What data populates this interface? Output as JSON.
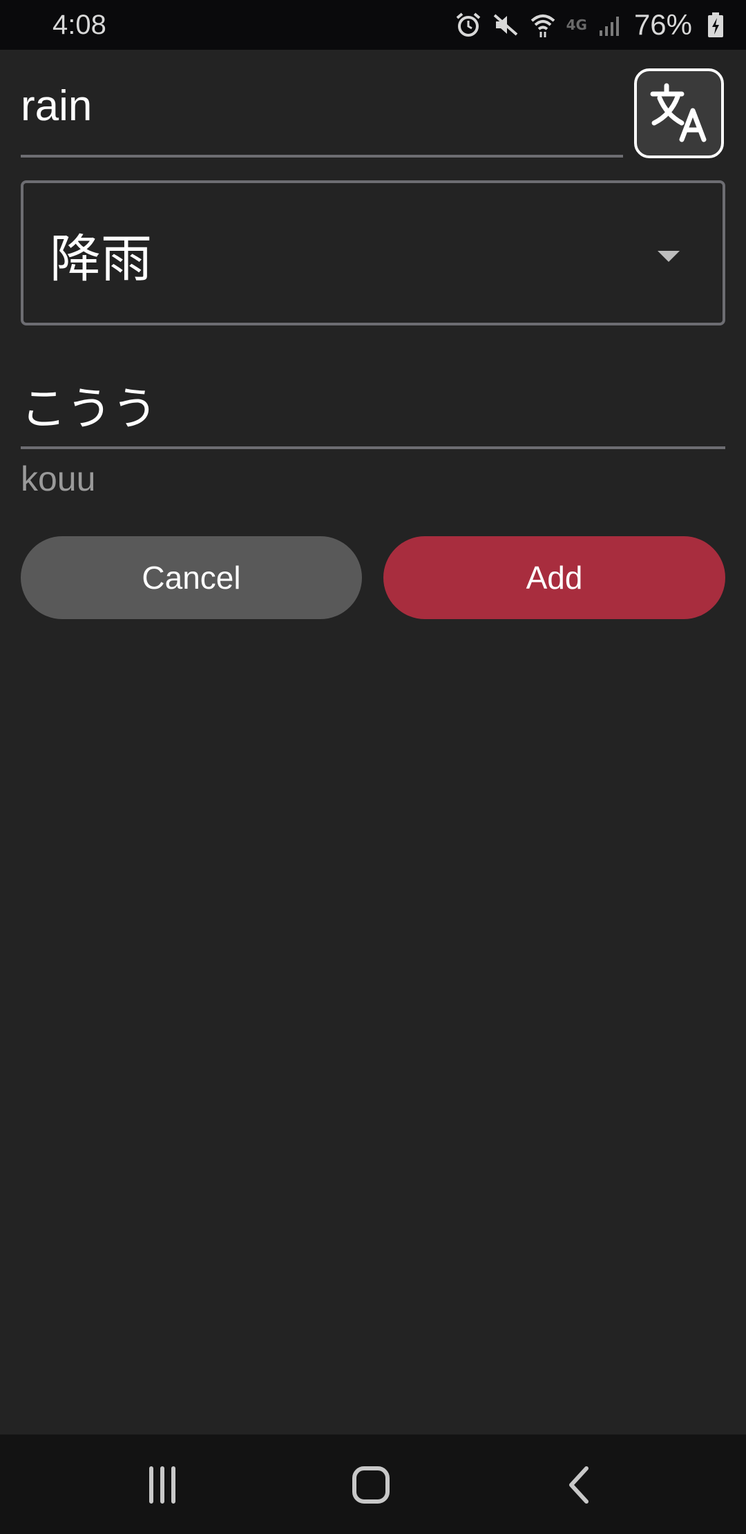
{
  "status_bar": {
    "time": "4:08",
    "battery_percent": "76%",
    "network": "4G",
    "icons": [
      "alarm-icon",
      "mute-icon",
      "wifi-icon",
      "signal-icon",
      "battery-charging-icon"
    ]
  },
  "form": {
    "word_value": "rain",
    "translation_selected": "降雨",
    "reading_value": "こうう",
    "romaji": "kouu"
  },
  "buttons": {
    "cancel_label": "Cancel",
    "add_label": "Add"
  },
  "translate_button": {
    "icon": "translate-icon"
  },
  "nav_bar": {
    "icons": [
      "recent-apps-icon",
      "home-icon",
      "back-icon"
    ]
  },
  "colors": {
    "background": "#232323",
    "accent": "#a82d3e",
    "cancel": "#595959",
    "underline": "#6d6d72"
  }
}
